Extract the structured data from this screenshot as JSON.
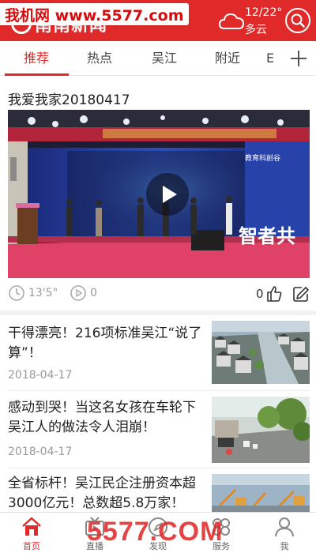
{
  "header": {
    "app_name": "南南新闻",
    "watermark": "我机网 www.5577.com",
    "weather_temp": "12/22°",
    "weather_desc": "多云",
    "bg_color": "#e02a2a"
  },
  "tabs": [
    {
      "label": "推荐",
      "active": true
    },
    {
      "label": "热点",
      "active": false
    },
    {
      "label": "吴江",
      "active": false
    },
    {
      "label": "附近",
      "active": false
    },
    {
      "label": "E",
      "active": false
    }
  ],
  "feature": {
    "title": "我爱我家20180417",
    "banner_text": "教育科創谷",
    "stage_text": "智者共",
    "duration": "13'5\"",
    "plays": "0",
    "likes": "0"
  },
  "news": [
    {
      "title": "干得漂亮！216项标准吴江“说了算”！",
      "date": "2018-04-17",
      "thumb": "canal-icon"
    },
    {
      "title": "感动到哭！当这名女孩在车轮下吴江人的做法令人泪崩！",
      "date": "2018-04-17",
      "thumb": "street-icon"
    },
    {
      "title": "全省标杆！吴江民企注册资本超3000亿元！总数超5.8万家！",
      "date": "",
      "thumb": "factory-icon"
    }
  ],
  "bottom_nav": [
    {
      "label": "首页",
      "icon": "home-icon",
      "active": true
    },
    {
      "label": "直播",
      "icon": "tv-icon",
      "active": false
    },
    {
      "label": "发现",
      "icon": "compass-icon",
      "active": false
    },
    {
      "label": "服务",
      "icon": "grid-icon",
      "active": false
    },
    {
      "label": "我",
      "icon": "user-icon",
      "active": false
    }
  ],
  "bottom_watermark": "5577.COM"
}
